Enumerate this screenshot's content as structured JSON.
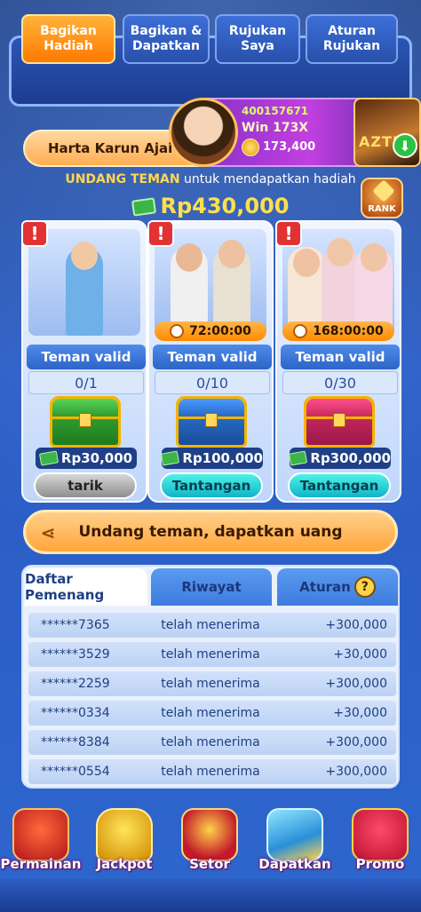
{
  "tabs": [
    {
      "label": "Bagikan\nHadiah",
      "active": true
    },
    {
      "label": "Bagikan &\nDapatkan",
      "active": false
    },
    {
      "label": "Rujukan\nSaya",
      "active": false
    },
    {
      "label": "Aturan\nRujukan",
      "active": false
    }
  ],
  "banner": {
    "title": "Harta Karun Ajai",
    "win_id": "400157671",
    "win_multiplier": "Win 173X",
    "win_amount": "173,400",
    "game_name": "AZTI",
    "icon": "download-icon"
  },
  "invite": {
    "highlight": "UNDANG TEMAN",
    "text": " untuk mendapatkan hadiah",
    "rank_label": "RANK",
    "total": "Rp430,000"
  },
  "cards": [
    {
      "timer": "",
      "valid_label": "Teman valid",
      "progress": "0/1",
      "reward": "Rp30,000",
      "button": "tarik",
      "button_style": "grey",
      "chest_color": "green"
    },
    {
      "timer": "72:00:00",
      "valid_label": "Teman valid",
      "progress": "0/10",
      "reward": "Rp100,000",
      "button": "Tantangan",
      "button_style": "teal",
      "chest_color": "blue"
    },
    {
      "timer": "168:00:00",
      "valid_label": "Teman valid",
      "progress": "0/30",
      "reward": "Rp300,000",
      "button": "Tantangan",
      "button_style": "teal",
      "chest_color": "red"
    }
  ],
  "share_button": {
    "label": "Undang teman, dapatkan uang"
  },
  "panel": {
    "tabs": [
      "Daftar Pemenang",
      "Riwayat",
      "Aturan"
    ],
    "rows": [
      {
        "user": "******7365",
        "status": "telah menerima",
        "amount": "+300,000"
      },
      {
        "user": "******3529",
        "status": "telah menerima",
        "amount": "+30,000"
      },
      {
        "user": "******2259",
        "status": "telah menerima",
        "amount": "+300,000"
      },
      {
        "user": "******0334",
        "status": "telah menerima",
        "amount": "+30,000"
      },
      {
        "user": "******8384",
        "status": "telah menerima",
        "amount": "+300,000"
      },
      {
        "user": "******0554",
        "status": "telah menerima",
        "amount": "+300,000"
      }
    ]
  },
  "bottom_nav": [
    {
      "label": "Permainan",
      "icon": "slot-machine-icon"
    },
    {
      "label": "Jackpot",
      "icon": "trophy-icon"
    },
    {
      "label": "Setor",
      "icon": "coin-chest-icon"
    },
    {
      "label": "Dapatkan",
      "icon": "phone-coins-icon"
    },
    {
      "label": "Promo",
      "icon": "gift-box-icon"
    }
  ],
  "colors": {
    "accent_orange": "#ff8a00",
    "gold": "#ffe04a",
    "teal": "#11b4c8",
    "background_blue": "#2a5bc4"
  }
}
